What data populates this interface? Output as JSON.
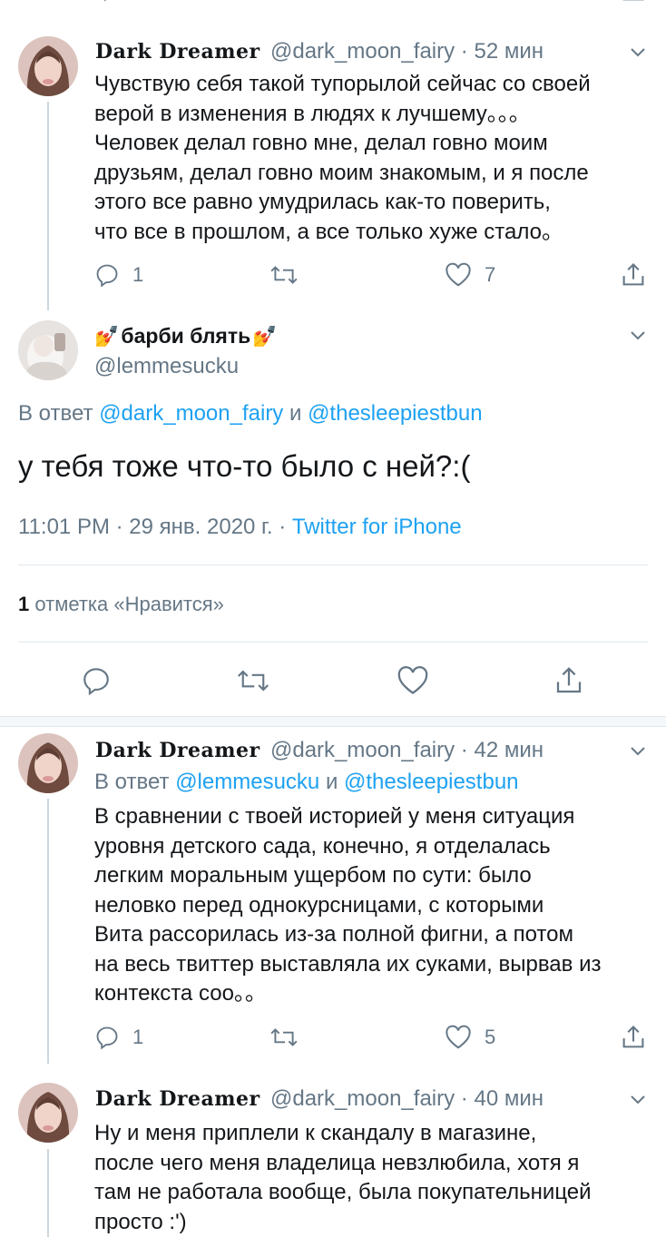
{
  "tweet1": {
    "display_name": "Dark Dreamer",
    "handle": "@dark_moon_fairy",
    "time": "52 мин",
    "text": "Чувствую себя такой тупорылой сейчас со своей\nверой в изменения в людях к лучшему。。。\nЧеловек делал говно мне, делал говно моим\nдрузьям, делал говно моим знакомым, и я после\nэтого все равно умудрилась как-то поверить,\nчто все в прошлом, а все только хуже стало。",
    "replies": "1",
    "likes": "7"
  },
  "main": {
    "display_name": "барби блять",
    "name_emoji_left": "💅",
    "name_emoji_right": "💅",
    "handle": "@lemmesucku",
    "reply_prefix": "В ответ",
    "reply_to_1": "@dark_moon_fairy",
    "reply_and": "и",
    "reply_to_2": "@thesleepiestbun",
    "text": "у тебя тоже что-то было с ней?:(",
    "time": "11:01 PM",
    "date": "29 янв. 2020 г.",
    "source": "Twitter for iPhone",
    "likes_count": "1",
    "likes_label": "отметка «Нравится»"
  },
  "tweet2": {
    "display_name": "Dark Dreamer",
    "handle": "@dark_moon_fairy",
    "time": "42 мин",
    "reply_prefix": "В ответ",
    "reply_to_1": "@lemmesucku",
    "reply_and": "и",
    "reply_to_2": "@thesleepiestbun",
    "text": "В сравнении с твоей историей у меня ситуация\nуровня детского сада, конечно, я отделалась\nлегким моральным ущербом по сути: было\nнеловко перед однокурсницами, с которыми\nВита рассорилась из-за полной фигни, а потом\nна весь твиттер выставляла их суками, вырвав из\nконтекста соо。。",
    "replies": "1",
    "likes": "5"
  },
  "tweet3": {
    "display_name": "Dark Dreamer",
    "handle": "@dark_moon_fairy",
    "time": "40 мин",
    "text": "Ну и меня приплели к скандалу в магазине,\nпосле чего меня владелица невзлюбила, хотя я\nтам не работала вообще, была покупательницей\nпросто :')"
  },
  "colors": {
    "text": "#14171a",
    "secondary": "#657786",
    "link": "#1da1f2",
    "divider": "#e1e8ed"
  },
  "icons": [
    "reply-icon",
    "retweet-icon",
    "like-icon",
    "share-icon",
    "chevron-down-icon"
  ]
}
